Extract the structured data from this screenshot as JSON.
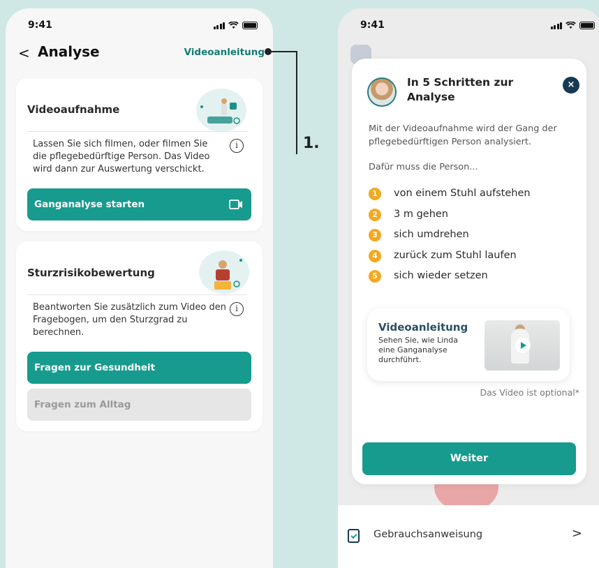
{
  "left": {
    "status_time": "9:41",
    "nav": {
      "back": "<",
      "title": "Analyse",
      "link": "Videoanleitung"
    },
    "card1": {
      "title": "Videoaufnahme",
      "text": "Lassen Sie sich filmen, oder filmen Sie die pflegebedürftige Person. Das Video wird dann zur Auswertung verschickt.",
      "info": "i",
      "button": "Ganganalyse starten",
      "button_icon": "video-camera-icon"
    },
    "card2": {
      "title": "Sturzrisikobewertung",
      "text": "Beantworten Sie zusätzlich zum Video den Fragebogen, um den  Sturzgrad zu berechnen.",
      "info": "i",
      "button_primary": "Fragen zur Gesundheit",
      "button_secondary": "Fragen zum Alltag"
    }
  },
  "annotation": {
    "label": "1."
  },
  "right": {
    "status_time": "9:41",
    "modal": {
      "title": "In 5 Schritten zur Analyse",
      "close": "×",
      "intro": "Mit der Videoaufnahme wird der Gang der pflegebedürftigen Person analysiert.",
      "lead": "Dafür muss die Person...",
      "steps": [
        {
          "num": "1",
          "text": "von einem Stuhl aufstehen"
        },
        {
          "num": "2",
          "text": "3 m gehen"
        },
        {
          "num": "3",
          "text": "sich umdrehen"
        },
        {
          "num": "4",
          "text": "zurück zum Stuhl laufen"
        },
        {
          "num": "5",
          "text": "sich wieder setzen"
        }
      ],
      "video_card": {
        "title": "Videoanleitung",
        "text": "Sehen Sie, wie Linda eine Ganganalyse durchführt."
      },
      "optional": "Das Video ist optional*",
      "button": "Weiter"
    },
    "bottom": {
      "label": "Gebrauchsanweisung",
      "chevron": ">"
    }
  },
  "colors": {
    "accent": "#179b8e",
    "step_badge": "#f5a81e",
    "navy": "#173a52"
  }
}
